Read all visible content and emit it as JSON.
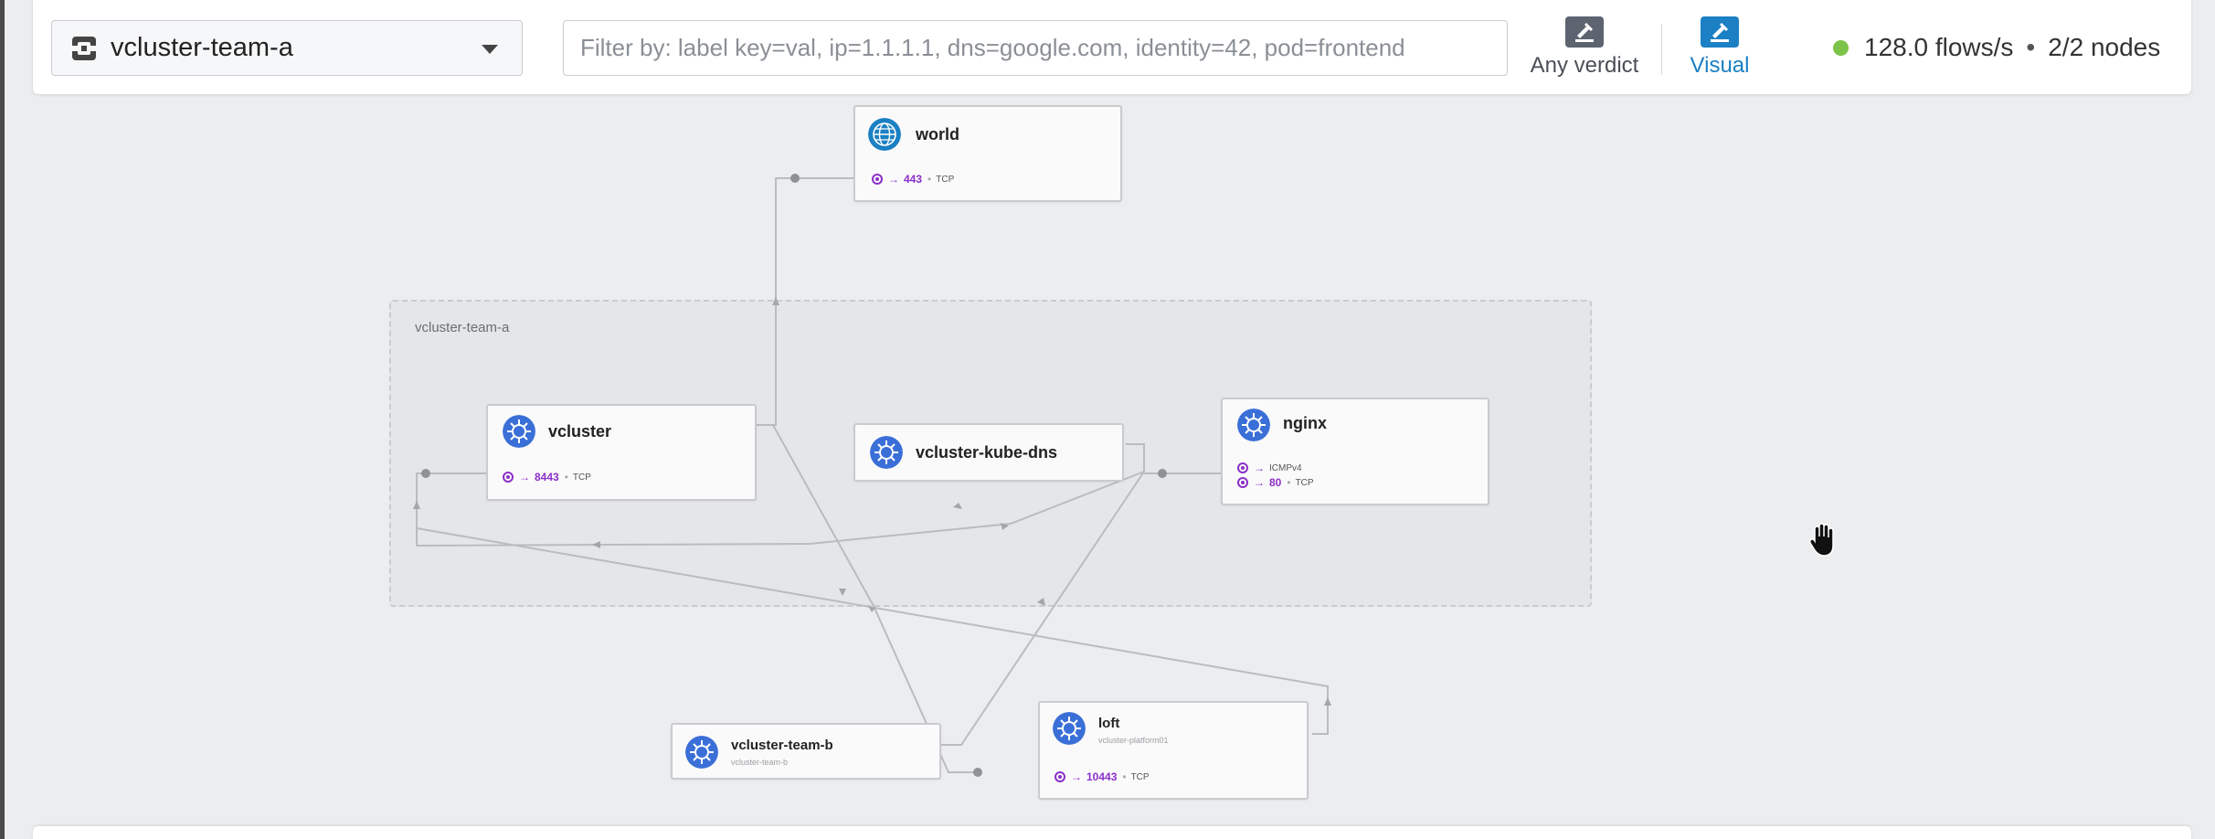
{
  "toolbar": {
    "namespace": "vcluster-team-a",
    "filter_placeholder": "Filter by: label key=val, ip=1.1.1.1, dns=google.com, identity=42, pod=frontend",
    "verdict_label": "Any verdict",
    "visual_label": "Visual",
    "status_dot_color": "#7cc348",
    "flows": "128.0 flows/s",
    "separator": "•",
    "nodes": "2/2 nodes",
    "accent_color": "#1b80c4"
  },
  "graph": {
    "namespace_box_label": "vcluster-team-a",
    "nodes": {
      "world": {
        "title": "world",
        "icon": "globe-icon",
        "ports": [
          {
            "port": "443",
            "protocol": "TCP"
          }
        ]
      },
      "vcluster": {
        "title": "vcluster",
        "icon": "kubernetes-icon",
        "ports": [
          {
            "port": "8443",
            "protocol": "TCP"
          }
        ]
      },
      "kube_dns": {
        "title": "vcluster-kube-dns",
        "icon": "kubernetes-icon",
        "ports": []
      },
      "nginx": {
        "title": "nginx",
        "icon": "kubernetes-icon",
        "ports": [
          {
            "port": "",
            "protocol": "ICMPv4"
          },
          {
            "port": "80",
            "protocol": "TCP"
          }
        ]
      },
      "team_b": {
        "title": "vcluster-team-b",
        "subtitle": "vcluster-team-b",
        "icon": "kubernetes-icon",
        "ports": []
      },
      "loft": {
        "title": "loft",
        "subtitle": "vcluster-platform01",
        "icon": "kubernetes-icon",
        "ports": [
          {
            "port": "10443",
            "protocol": "TCP"
          }
        ]
      }
    },
    "port_arrow": "→",
    "port_sep": "•",
    "port_color": "#8b2fc9",
    "k8s_icon_color": "#3a6fd8"
  }
}
